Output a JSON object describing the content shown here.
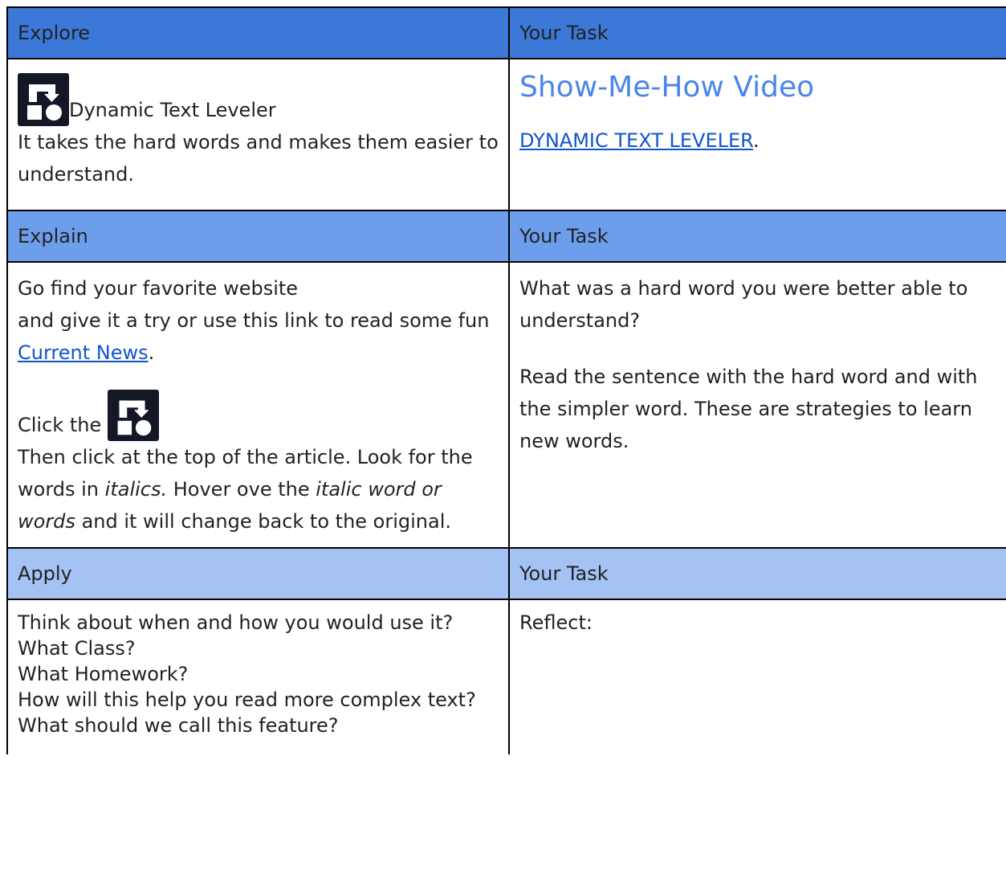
{
  "rows": [
    {
      "header_left": "Explore",
      "header_right": "Your Task"
    },
    {
      "header_left": "Explain",
      "header_right": "Your Task"
    },
    {
      "header_left": "Apply",
      "header_right": "Your Task"
    }
  ],
  "explore": {
    "tool_name": "Dynamic Text Leveler",
    "description": "It takes the hard words and makes them easier to understand.",
    "video_title": "Show-Me-How Video",
    "video_link": "DYNAMIC TEXT LEVELER",
    "video_link_suffix": "."
  },
  "explain": {
    "line1": "Go find your favorite website",
    "line2": "and give it a try or use this link to read some fun",
    "news_link": "Current News",
    "news_suffix": ".",
    "click_the": "Click the",
    "steps_part1": "Then click at the top of the article.  Look for the words in",
    "italics_word": "italics.",
    "steps_part2": "  Hover ove the",
    "italic_phrase": "italic word or words",
    "steps_part3": "and it will change back to the original.",
    "task_q1": "What was a hard word you were better able to understand?",
    "task_q2": "Read the sentence with the hard word and with the simpler word.  These are strategies to learn new words."
  },
  "apply": {
    "q1": "Think about when and how you would use it?",
    "q2": "What Class?",
    "q3": "What Homework?",
    "q4": "How will this help you read more complex text?",
    "q5": "What should we call this feature?",
    "reflect": "Reflect:"
  },
  "colors": {
    "header_dark": "#3c78d8",
    "header_mid": "#6d9eeb",
    "header_light": "#a4c2f4",
    "link": "#1155cc",
    "title_blue": "#4a86e8"
  },
  "icons": {
    "tool_icon": "dynamic-text-leveler-icon"
  }
}
